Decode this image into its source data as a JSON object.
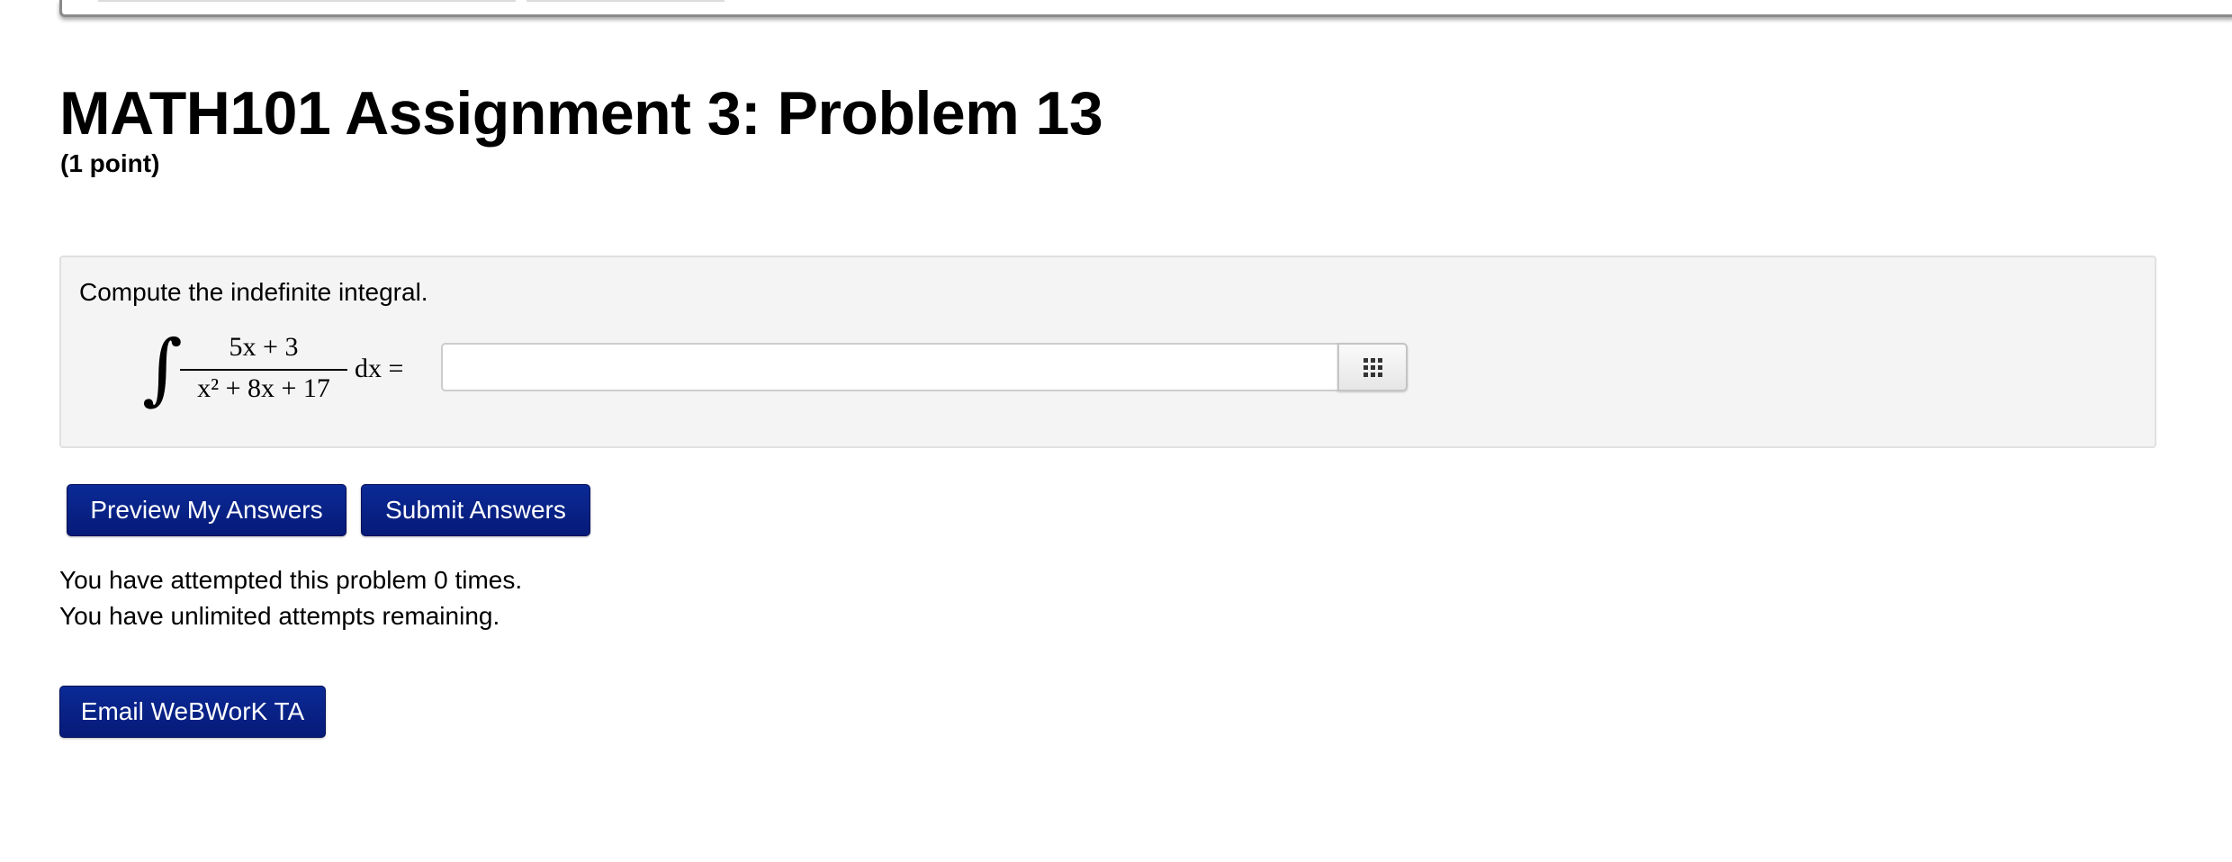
{
  "header": {
    "title": "MATH101 Assignment 3: Problem 13",
    "points": "(1 point)"
  },
  "problem": {
    "prompt": "Compute the indefinite integral.",
    "integral_symbol": "∫",
    "numerator": "5x + 3",
    "denominator": "x² + 8x + 17",
    "differential": "dx =",
    "answer_value": "",
    "answer_placeholder": "",
    "palette_icon": "grid-icon"
  },
  "actions": {
    "preview_label": "Preview My Answers",
    "submit_label": "Submit Answers",
    "email_label": "Email WeBWorK TA"
  },
  "status": {
    "attempts": "You have attempted this problem 0 times.",
    "remaining": "You have unlimited attempts remaining."
  },
  "colors": {
    "button_bg": "#0b2a96",
    "problem_bg": "#f4f4f4"
  }
}
